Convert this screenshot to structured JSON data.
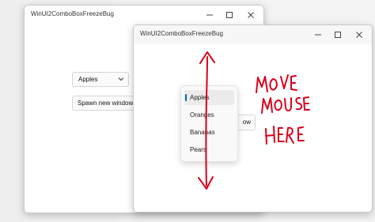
{
  "background_window": {
    "title": "WinUI2ComboBoxFreezeBug",
    "combo_value": "Apples",
    "spawn_button": "Spawn new window"
  },
  "foreground_window": {
    "title": "WinUI2ComboBoxFreezeBug",
    "spawn_button_partial": "ow",
    "dropdown_options": [
      "Apples",
      "Oranges",
      "Bananas",
      "Pears"
    ],
    "selected_option": "Apples"
  },
  "annotation": {
    "lines": [
      "MOVE",
      "MOUSE",
      "HERE"
    ],
    "ink_color": "#d8001c"
  },
  "accent_color": "#0067c0"
}
